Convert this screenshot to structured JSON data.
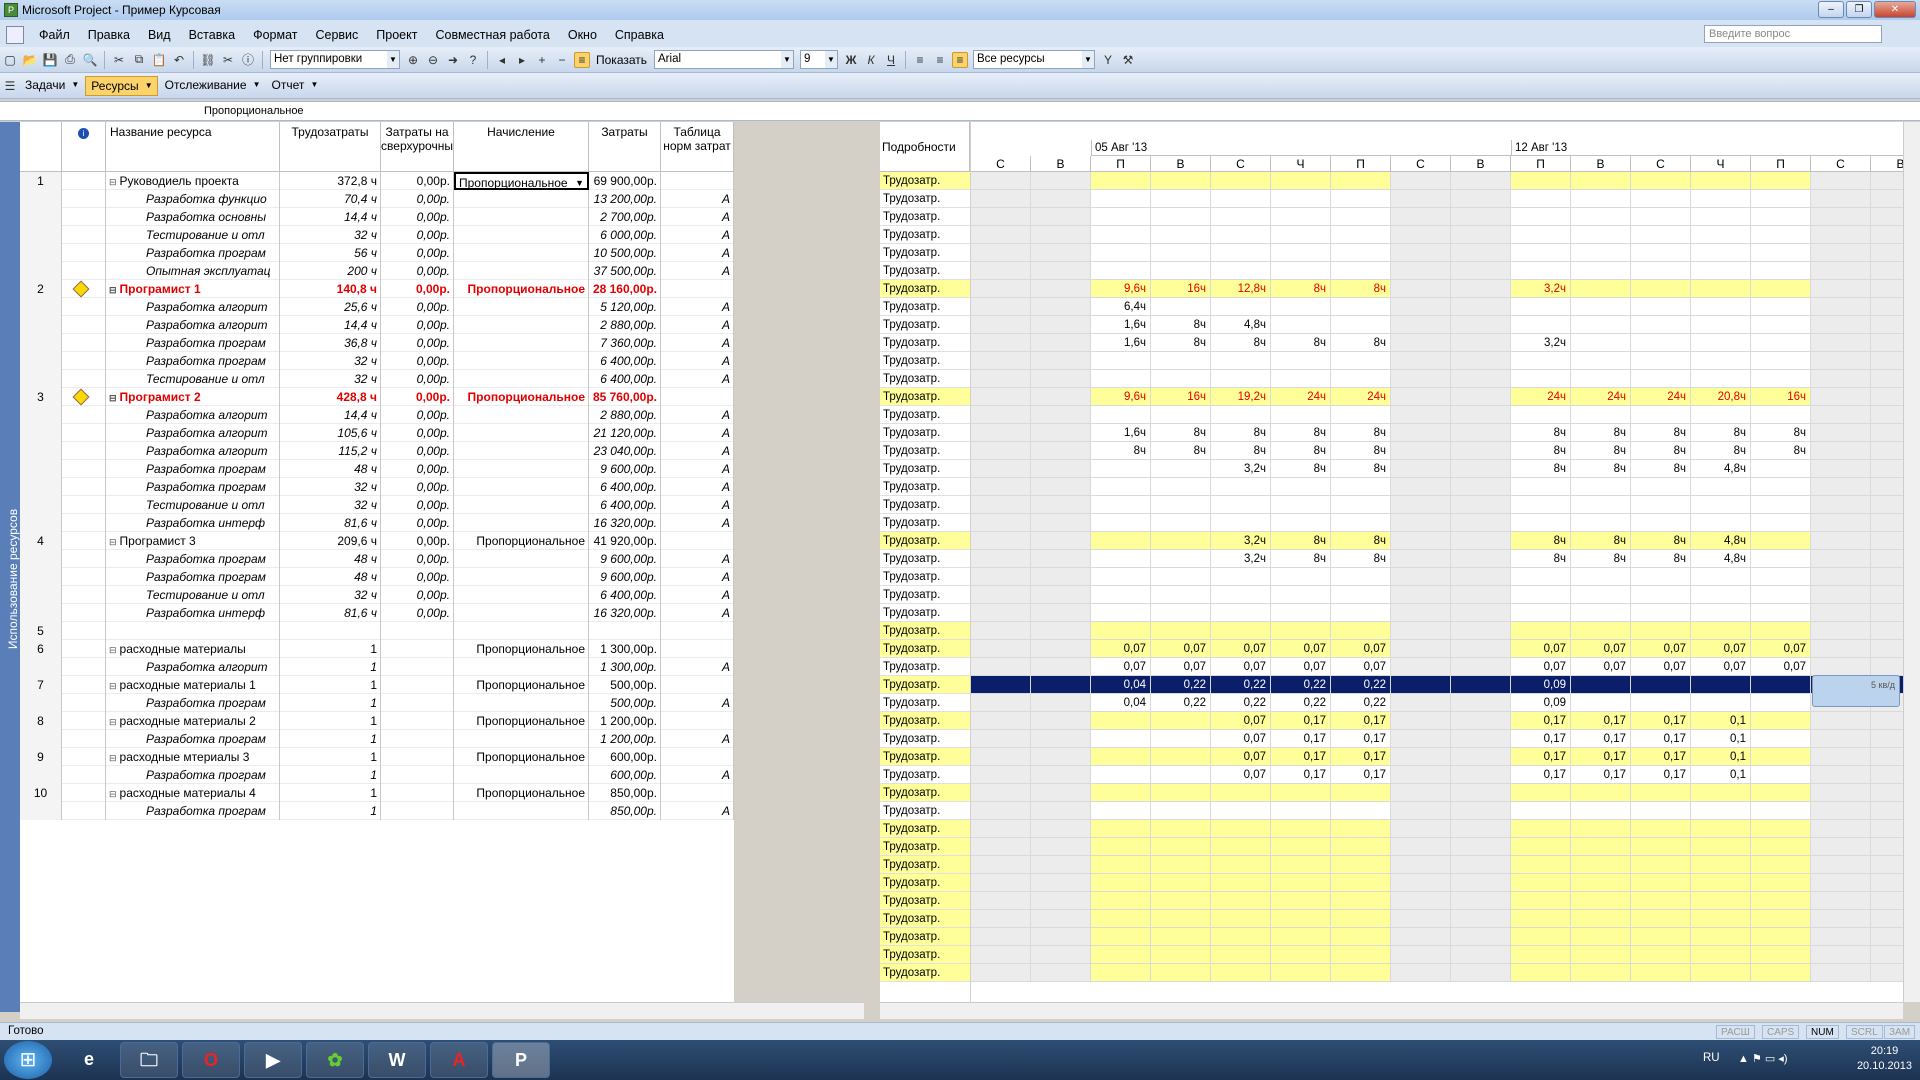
{
  "window": {
    "title": "Microsoft Project - Пример Курсовая",
    "help_placeholder": "Введите вопрос"
  },
  "menu": [
    "Файл",
    "Правка",
    "Вид",
    "Вставка",
    "Формат",
    "Сервис",
    "Проект",
    "Совместная работа",
    "Окно",
    "Справка"
  ],
  "toolbar": {
    "grouping": "Нет группировки",
    "show": "Показать",
    "font": "Arial",
    "font_size": "9",
    "bold": "Ж",
    "italic": "К",
    "underline": "Ч",
    "filter": "Все ресурсы"
  },
  "views": {
    "tasks": "Задачи",
    "resources": "Ресурсы",
    "tracking": "Отслеживание",
    "report": "Отчет"
  },
  "edit_value": "Пропорциональное",
  "side_tab": "Использование ресурсов",
  "columns": {
    "name": "Название ресурса",
    "work": "Трудозатраты",
    "ot_cost": "Затраты на сверхурочны",
    "accrue": "Начисление",
    "cost": "Затраты",
    "rate_table": "Таблица норм затрат"
  },
  "rows": [
    {
      "id": "1",
      "name": "Руководиель проекта",
      "work": "372,8 ч",
      "ot": "0,00р.",
      "accrue": "Пропорциональное",
      "cost": "69 900,00р.",
      "tbl": "",
      "type": "res"
    },
    {
      "id": "",
      "name": "Разработка функцио",
      "work": "70,4 ч",
      "ot": "0,00р.",
      "accrue": "",
      "cost": "13 200,00р.",
      "tbl": "A",
      "type": "sub"
    },
    {
      "id": "",
      "name": "Разработка основны",
      "work": "14,4 ч",
      "ot": "0,00р.",
      "accrue": "",
      "cost": "2 700,00р.",
      "tbl": "A",
      "type": "sub"
    },
    {
      "id": "",
      "name": "Тестирование и отл",
      "work": "32 ч",
      "ot": "0,00р.",
      "accrue": "",
      "cost": "6 000,00р.",
      "tbl": "A",
      "type": "sub"
    },
    {
      "id": "",
      "name": "Разработка програм",
      "work": "56 ч",
      "ot": "0,00р.",
      "accrue": "",
      "cost": "10 500,00р.",
      "tbl": "A",
      "type": "sub"
    },
    {
      "id": "",
      "name": "Опытная эксплуатац",
      "work": "200 ч",
      "ot": "0,00р.",
      "accrue": "",
      "cost": "37 500,00р.",
      "tbl": "A",
      "type": "sub"
    },
    {
      "id": "2",
      "name": "Програмист 1",
      "work": "140,8 ч",
      "ot": "0,00р.",
      "accrue": "Пропорциональное",
      "cost": "28 160,00р.",
      "tbl": "",
      "type": "red"
    },
    {
      "id": "",
      "name": "Разработка алгорит",
      "work": "25,6 ч",
      "ot": "0,00р.",
      "accrue": "",
      "cost": "5 120,00р.",
      "tbl": "A",
      "type": "sub"
    },
    {
      "id": "",
      "name": "Разработка алгорит",
      "work": "14,4 ч",
      "ot": "0,00р.",
      "accrue": "",
      "cost": "2 880,00р.",
      "tbl": "A",
      "type": "sub"
    },
    {
      "id": "",
      "name": "Разработка програм",
      "work": "36,8 ч",
      "ot": "0,00р.",
      "accrue": "",
      "cost": "7 360,00р.",
      "tbl": "A",
      "type": "sub"
    },
    {
      "id": "",
      "name": "Разработка програм",
      "work": "32 ч",
      "ot": "0,00р.",
      "accrue": "",
      "cost": "6 400,00р.",
      "tbl": "A",
      "type": "sub"
    },
    {
      "id": "",
      "name": "Тестирование и отл",
      "work": "32 ч",
      "ot": "0,00р.",
      "accrue": "",
      "cost": "6 400,00р.",
      "tbl": "A",
      "type": "sub"
    },
    {
      "id": "3",
      "name": "Програмист 2",
      "work": "428,8 ч",
      "ot": "0,00р.",
      "accrue": "Пропорциональное",
      "cost": "85 760,00р.",
      "tbl": "",
      "type": "red"
    },
    {
      "id": "",
      "name": "Разработка алгорит",
      "work": "14,4 ч",
      "ot": "0,00р.",
      "accrue": "",
      "cost": "2 880,00р.",
      "tbl": "A",
      "type": "sub"
    },
    {
      "id": "",
      "name": "Разработка алгорит",
      "work": "105,6 ч",
      "ot": "0,00р.",
      "accrue": "",
      "cost": "21 120,00р.",
      "tbl": "A",
      "type": "sub"
    },
    {
      "id": "",
      "name": "Разработка алгорит",
      "work": "115,2 ч",
      "ot": "0,00р.",
      "accrue": "",
      "cost": "23 040,00р.",
      "tbl": "A",
      "type": "sub"
    },
    {
      "id": "",
      "name": "Разработка програм",
      "work": "48 ч",
      "ot": "0,00р.",
      "accrue": "",
      "cost": "9 600,00р.",
      "tbl": "A",
      "type": "sub"
    },
    {
      "id": "",
      "name": "Разработка програм",
      "work": "32 ч",
      "ot": "0,00р.",
      "accrue": "",
      "cost": "6 400,00р.",
      "tbl": "A",
      "type": "sub"
    },
    {
      "id": "",
      "name": "Тестирование и отл",
      "work": "32 ч",
      "ot": "0,00р.",
      "accrue": "",
      "cost": "6 400,00р.",
      "tbl": "A",
      "type": "sub"
    },
    {
      "id": "",
      "name": "Разработка интерф",
      "work": "81,6 ч",
      "ot": "0,00р.",
      "accrue": "",
      "cost": "16 320,00р.",
      "tbl": "A",
      "type": "sub"
    },
    {
      "id": "4",
      "name": "Програмист 3",
      "work": "209,6 ч",
      "ot": "0,00р.",
      "accrue": "Пропорциональное",
      "cost": "41 920,00р.",
      "tbl": "",
      "type": "res"
    },
    {
      "id": "",
      "name": "Разработка програм",
      "work": "48 ч",
      "ot": "0,00р.",
      "accrue": "",
      "cost": "9 600,00р.",
      "tbl": "A",
      "type": "sub"
    },
    {
      "id": "",
      "name": "Разработка програм",
      "work": "48 ч",
      "ot": "0,00р.",
      "accrue": "",
      "cost": "9 600,00р.",
      "tbl": "A",
      "type": "sub"
    },
    {
      "id": "",
      "name": "Тестирование и отл",
      "work": "32 ч",
      "ot": "0,00р.",
      "accrue": "",
      "cost": "6 400,00р.",
      "tbl": "A",
      "type": "sub"
    },
    {
      "id": "",
      "name": "Разработка интерф",
      "work": "81,6 ч",
      "ot": "0,00р.",
      "accrue": "",
      "cost": "16 320,00р.",
      "tbl": "A",
      "type": "sub"
    },
    {
      "id": "5",
      "name": "",
      "work": "",
      "ot": "",
      "accrue": "",
      "cost": "",
      "tbl": "",
      "type": "empty"
    },
    {
      "id": "6",
      "name": "расходные материалы",
      "work": "1",
      "ot": "",
      "accrue": "Пропорциональное",
      "cost": "1 300,00р.",
      "tbl": "",
      "type": "res"
    },
    {
      "id": "",
      "name": "Разработка алгорит",
      "work": "1",
      "ot": "",
      "accrue": "",
      "cost": "1 300,00р.",
      "tbl": "A",
      "type": "sub"
    },
    {
      "id": "7",
      "name": "расходные материалы 1",
      "work": "1",
      "ot": "",
      "accrue": "Пропорциональное",
      "cost": "500,00р.",
      "tbl": "",
      "type": "res"
    },
    {
      "id": "",
      "name": "Разработка програм",
      "work": "1",
      "ot": "",
      "accrue": "",
      "cost": "500,00р.",
      "tbl": "A",
      "type": "sub"
    },
    {
      "id": "8",
      "name": "расходные материалы 2",
      "work": "1",
      "ot": "",
      "accrue": "Пропорциональное",
      "cost": "1 200,00р.",
      "tbl": "",
      "type": "res"
    },
    {
      "id": "",
      "name": "Разработка програм",
      "work": "1",
      "ot": "",
      "accrue": "",
      "cost": "1 200,00р.",
      "tbl": "A",
      "type": "sub"
    },
    {
      "id": "9",
      "name": "расходные мтериалы 3",
      "work": "1",
      "ot": "",
      "accrue": "Пропорциональное",
      "cost": "600,00р.",
      "tbl": "",
      "type": "res"
    },
    {
      "id": "",
      "name": "Разработка програм",
      "work": "1",
      "ot": "",
      "accrue": "",
      "cost": "600,00р.",
      "tbl": "A",
      "type": "sub"
    },
    {
      "id": "10",
      "name": "расходные материалы 4",
      "work": "1",
      "ot": "",
      "accrue": "Пропорциональное",
      "cost": "850,00р.",
      "tbl": "",
      "type": "res"
    },
    {
      "id": "",
      "name": "Разработка програм",
      "work": "1",
      "ot": "",
      "accrue": "",
      "cost": "850,00р.",
      "tbl": "A",
      "type": "sub"
    }
  ],
  "details_header": "Подробности",
  "detail_label": "Трудозатр.",
  "weeks": [
    "05 Авг '13",
    "12 Авг '13"
  ],
  "days": [
    "С",
    "В",
    "П",
    "В",
    "С",
    "Ч",
    "П",
    "С",
    "В",
    "П",
    "В",
    "С",
    "Ч",
    "П",
    "С",
    "В"
  ],
  "timescale": [
    [
      "",
      "",
      "",
      "",
      "",
      "",
      "",
      "",
      "",
      "",
      "",
      "",
      "",
      "",
      "",
      ""
    ],
    [
      "",
      "",
      "",
      "",
      "",
      "",
      "",
      "",
      "",
      "",
      "",
      "",
      "",
      "",
      "",
      ""
    ],
    [
      "",
      "",
      "",
      "",
      "",
      "",
      "",
      "",
      "",
      "",
      "",
      "",
      "",
      "",
      "",
      ""
    ],
    [
      "",
      "",
      "",
      "",
      "",
      "",
      "",
      "",
      "",
      "",
      "",
      "",
      "",
      "",
      "",
      ""
    ],
    [
      "",
      "",
      "",
      "",
      "",
      "",
      "",
      "",
      "",
      "",
      "",
      "",
      "",
      "",
      "",
      ""
    ],
    [
      "",
      "",
      "",
      "",
      "",
      "",
      "",
      "",
      "",
      "",
      "",
      "",
      "",
      "",
      "",
      ""
    ],
    [
      "",
      "",
      "9,6ч",
      "16ч",
      "12,8ч",
      "8ч",
      "8ч",
      "",
      "",
      "3,2ч",
      "",
      "",
      "",
      "",
      "",
      ""
    ],
    [
      "",
      "",
      "6,4ч",
      "",
      "",
      "",
      "",
      "",
      "",
      "",
      "",
      "",
      "",
      "",
      "",
      ""
    ],
    [
      "",
      "",
      "1,6ч",
      "8ч",
      "4,8ч",
      "",
      "",
      "",
      "",
      "",
      "",
      "",
      "",
      "",
      "",
      ""
    ],
    [
      "",
      "",
      "1,6ч",
      "8ч",
      "8ч",
      "8ч",
      "8ч",
      "",
      "",
      "3,2ч",
      "",
      "",
      "",
      "",
      "",
      ""
    ],
    [
      "",
      "",
      "",
      "",
      "",
      "",
      "",
      "",
      "",
      "",
      "",
      "",
      "",
      "",
      "",
      ""
    ],
    [
      "",
      "",
      "",
      "",
      "",
      "",
      "",
      "",
      "",
      "",
      "",
      "",
      "",
      "",
      "",
      ""
    ],
    [
      "",
      "",
      "9,6ч",
      "16ч",
      "19,2ч",
      "24ч",
      "24ч",
      "",
      "",
      "24ч",
      "24ч",
      "24ч",
      "20,8ч",
      "16ч",
      "",
      ""
    ],
    [
      "",
      "",
      "",
      "",
      "",
      "",
      "",
      "",
      "",
      "",
      "",
      "",
      "",
      "",
      "",
      ""
    ],
    [
      "",
      "",
      "1,6ч",
      "8ч",
      "8ч",
      "8ч",
      "8ч",
      "",
      "",
      "8ч",
      "8ч",
      "8ч",
      "8ч",
      "8ч",
      "",
      ""
    ],
    [
      "",
      "",
      "8ч",
      "8ч",
      "8ч",
      "8ч",
      "8ч",
      "",
      "",
      "8ч",
      "8ч",
      "8ч",
      "8ч",
      "8ч",
      "",
      ""
    ],
    [
      "",
      "",
      "",
      "",
      "3,2ч",
      "8ч",
      "8ч",
      "",
      "",
      "8ч",
      "8ч",
      "8ч",
      "4,8ч",
      "",
      "",
      ""
    ],
    [
      "",
      "",
      "",
      "",
      "",
      "",
      "",
      "",
      "",
      "",
      "",
      "",
      "",
      "",
      "",
      ""
    ],
    [
      "",
      "",
      "",
      "",
      "",
      "",
      "",
      "",
      "",
      "",
      "",
      "",
      "",
      "",
      "",
      ""
    ],
    [
      "",
      "",
      "",
      "",
      "",
      "",
      "",
      "",
      "",
      "",
      "",
      "",
      "",
      "",
      "",
      ""
    ],
    [
      "",
      "",
      "",
      "",
      "3,2ч",
      "8ч",
      "8ч",
      "",
      "",
      "8ч",
      "8ч",
      "8ч",
      "4,8ч",
      "",
      "",
      ""
    ],
    [
      "",
      "",
      "",
      "",
      "3,2ч",
      "8ч",
      "8ч",
      "",
      "",
      "8ч",
      "8ч",
      "8ч",
      "4,8ч",
      "",
      "",
      ""
    ],
    [
      "",
      "",
      "",
      "",
      "",
      "",
      "",
      "",
      "",
      "",
      "",
      "",
      "",
      "",
      "",
      ""
    ],
    [
      "",
      "",
      "",
      "",
      "",
      "",
      "",
      "",
      "",
      "",
      "",
      "",
      "",
      "",
      "",
      ""
    ],
    [
      "",
      "",
      "",
      "",
      "",
      "",
      "",
      "",
      "",
      "",
      "",
      "",
      "",
      "",
      "",
      ""
    ],
    [
      "",
      "",
      "",
      "",
      "",
      "",
      "",
      "",
      "",
      "",
      "",
      "",
      "",
      "",
      "",
      ""
    ],
    [
      "",
      "",
      "0,07",
      "0,07",
      "0,07",
      "0,07",
      "0,07",
      "",
      "",
      "0,07",
      "0,07",
      "0,07",
      "0,07",
      "0,07",
      "",
      ""
    ],
    [
      "",
      "",
      "0,07",
      "0,07",
      "0,07",
      "0,07",
      "0,07",
      "",
      "",
      "0,07",
      "0,07",
      "0,07",
      "0,07",
      "0,07",
      "",
      ""
    ],
    [
      "",
      "",
      "0,04",
      "0,22",
      "0,22",
      "0,22",
      "0,22",
      "",
      "",
      "0,09",
      "",
      "",
      "",
      "",
      "",
      ""
    ],
    [
      "",
      "",
      "0,04",
      "0,22",
      "0,22",
      "0,22",
      "0,22",
      "",
      "",
      "0,09",
      "",
      "",
      "",
      "",
      "",
      ""
    ],
    [
      "",
      "",
      "",
      "",
      "0,07",
      "0,17",
      "0,17",
      "",
      "",
      "0,17",
      "0,17",
      "0,17",
      "0,1",
      "",
      "",
      ""
    ],
    [
      "",
      "",
      "",
      "",
      "0,07",
      "0,17",
      "0,17",
      "",
      "",
      "0,17",
      "0,17",
      "0,17",
      "0,1",
      "",
      "",
      ""
    ],
    [
      "",
      "",
      "",
      "",
      "0,07",
      "0,17",
      "0,17",
      "",
      "",
      "0,17",
      "0,17",
      "0,17",
      "0,1",
      "",
      "",
      ""
    ],
    [
      "",
      "",
      "",
      "",
      "0,07",
      "0,17",
      "0,17",
      "",
      "",
      "0,17",
      "0,17",
      "0,17",
      "0,1",
      "",
      "",
      ""
    ],
    [
      "",
      "",
      "",
      "",
      "",
      "",
      "",
      "",
      "",
      "",
      "",
      "",
      "",
      "",
      "",
      ""
    ],
    [
      "",
      "",
      "",
      "",
      "",
      "",
      "",
      "",
      "",
      "",
      "",
      "",
      "",
      "",
      "",
      ""
    ]
  ],
  "tooltip": "5 кв/д",
  "status": {
    "ready": "Готово",
    "ext": "РАСШ",
    "caps": "CAPS",
    "num": "NUM",
    "scrl": "SCRL",
    "zam": "ЗАМ"
  },
  "taskbar": {
    "lang": "RU",
    "time": "20:19",
    "date": "20.10.2013"
  }
}
